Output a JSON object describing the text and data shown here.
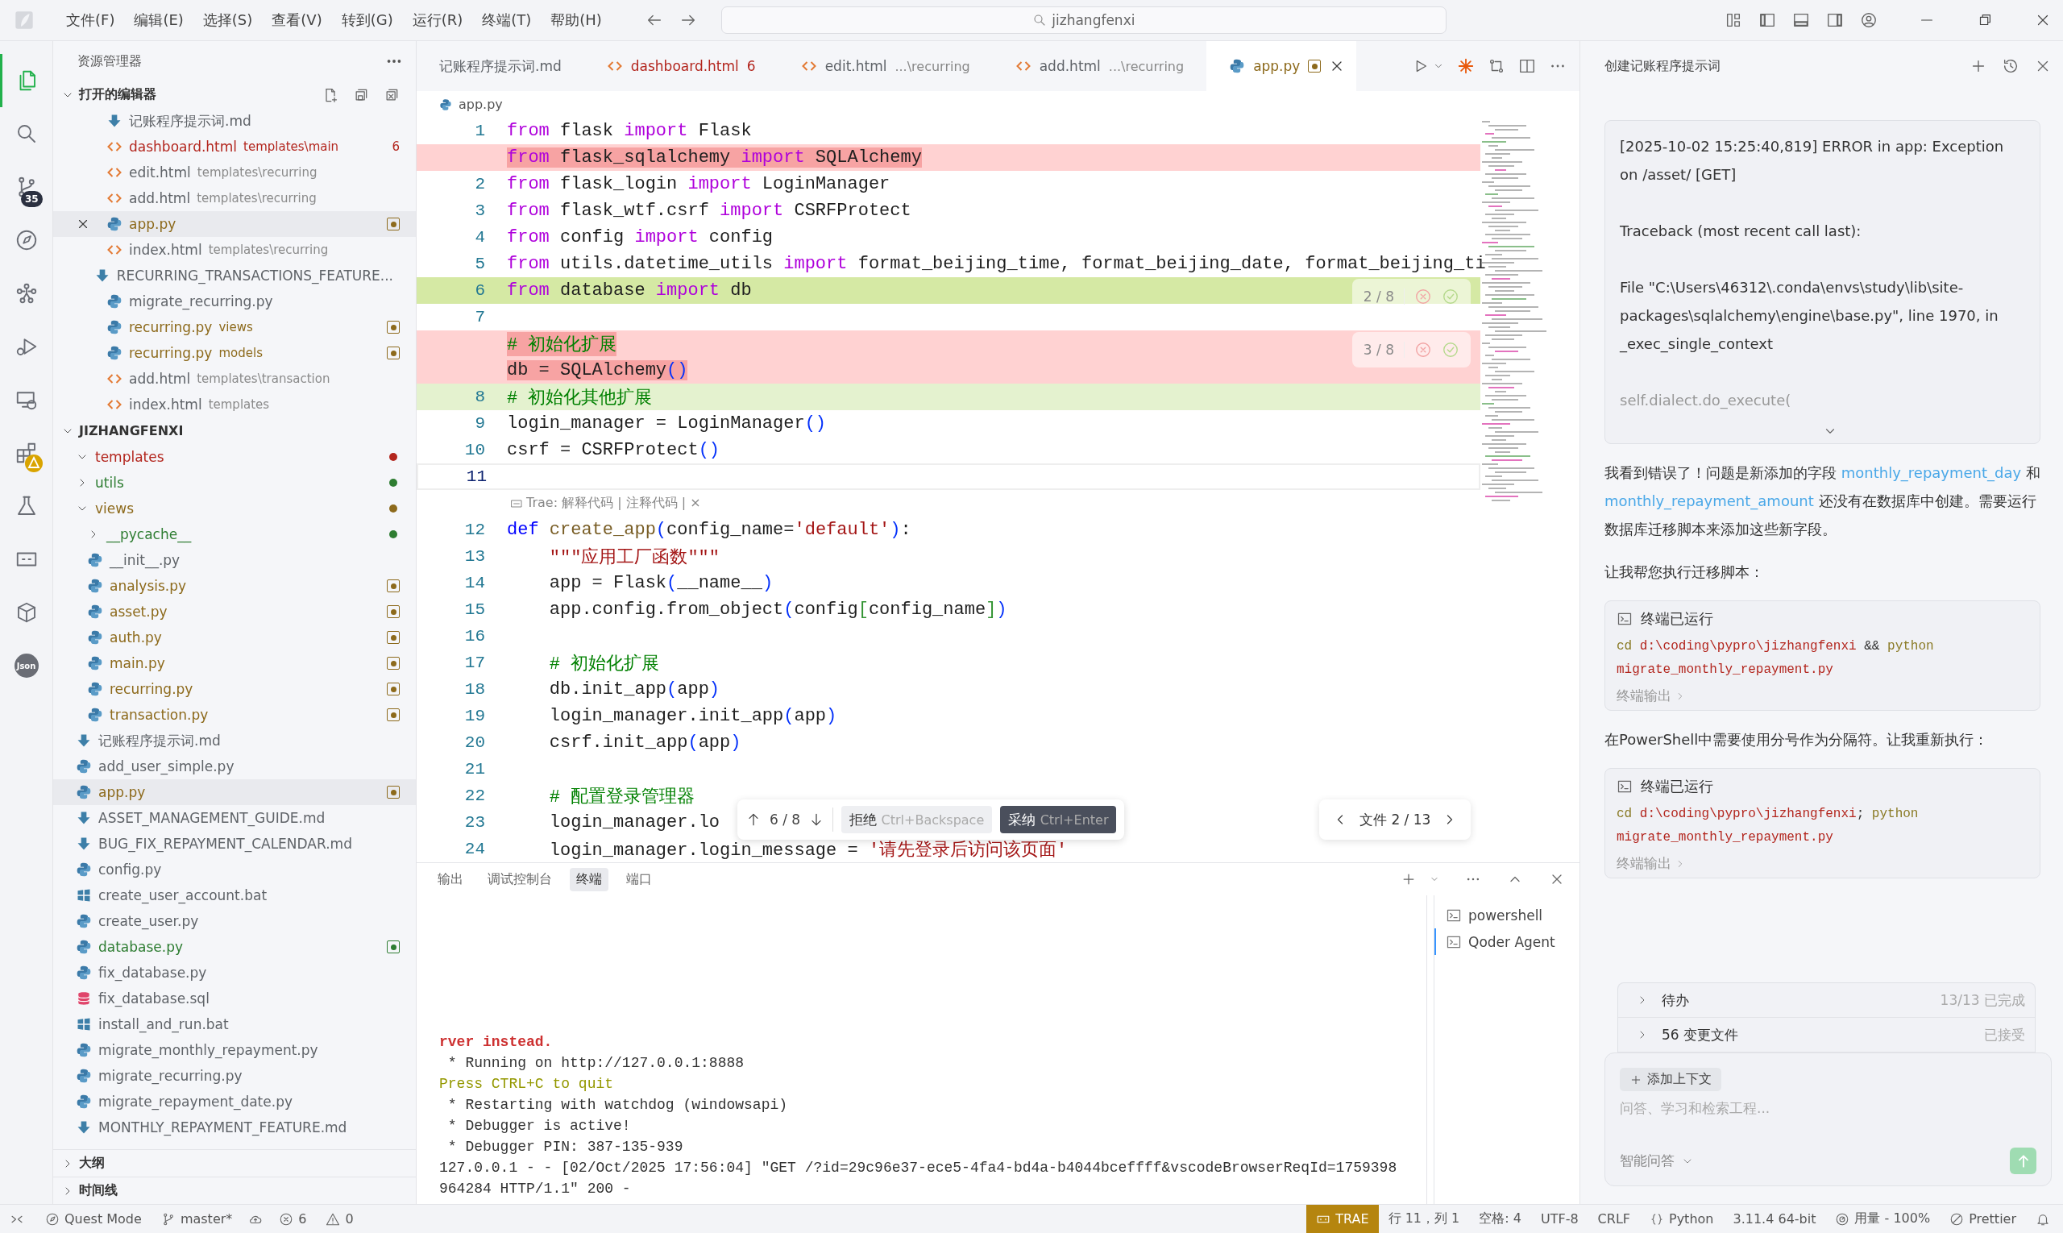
{
  "menu": [
    "文件(F)",
    "编辑(E)",
    "选择(S)",
    "查看(V)",
    "转到(G)",
    "运行(R)",
    "终端(T)",
    "帮助(H)"
  ],
  "command_center": "jizhangfenxi",
  "activity_bar": [
    {
      "kind": "explorer",
      "selected": true,
      "alert": false
    },
    {
      "kind": "search",
      "selected": false,
      "alert": false
    },
    {
      "kind": "source-control",
      "selected": false,
      "badge": "35",
      "alert": false
    },
    {
      "kind": "compass",
      "selected": false,
      "alert": false
    },
    {
      "kind": "graph",
      "selected": false,
      "alert": false
    },
    {
      "kind": "run-debug",
      "selected": false,
      "alert": false
    },
    {
      "kind": "remote",
      "selected": false,
      "alert": false
    },
    {
      "kind": "extensions",
      "selected": false,
      "alert": true
    },
    {
      "kind": "testing",
      "selected": false,
      "alert": false
    },
    {
      "kind": "chat",
      "selected": false,
      "alert": false
    },
    {
      "kind": "package",
      "selected": false,
      "alert": false
    },
    {
      "kind": "json",
      "selected": false,
      "label": "Json",
      "alert": false
    }
  ],
  "explorer": {
    "title": "资源管理器",
    "open_editors": {
      "title": "打开的编辑器",
      "expanded": true,
      "items": [
        {
          "name": "记账程序提示词.md",
          "kind": "md",
          "color": "#5f6368",
          "modified": false,
          "selected": false
        },
        {
          "name": "dashboard.html",
          "detail": "templates\\main",
          "kind": "html",
          "color": "#b3261e",
          "problems": "6",
          "modified": false,
          "selected": false
        },
        {
          "name": "edit.html",
          "detail": "templates\\recurring",
          "kind": "html",
          "color": "#5f6368",
          "modified": false,
          "selected": false
        },
        {
          "name": "add.html",
          "detail": "templates\\recurring",
          "kind": "html",
          "color": "#5f6368",
          "modified": false,
          "selected": false
        },
        {
          "name": "app.py",
          "kind": "py",
          "color": "#8d6a1c",
          "modified": true,
          "selected": true
        },
        {
          "name": "index.html",
          "detail": "templates\\recurring",
          "kind": "html",
          "color": "#5f6368",
          "modified": false,
          "selected": false
        },
        {
          "name": "RECURRING_TRANSACTIONS_FEATURE...",
          "kind": "md",
          "color": "#5f6368",
          "modified": false,
          "selected": false
        },
        {
          "name": "migrate_recurring.py",
          "kind": "py",
          "color": "#5f6368",
          "modified": false,
          "selected": false
        },
        {
          "name": "recurring.py",
          "detail": "views",
          "kind": "py",
          "color": "#8d6a1c",
          "modified": true,
          "selected": false
        },
        {
          "name": "recurring.py",
          "detail": "models",
          "kind": "py",
          "color": "#8d6a1c",
          "modified": true,
          "selected": false
        },
        {
          "name": "add.html",
          "detail": "templates\\transaction",
          "kind": "html",
          "color": "#5f6368",
          "modified": false,
          "selected": false
        },
        {
          "name": "index.html",
          "detail": "templates",
          "kind": "html",
          "color": "#5f6368",
          "modified": false,
          "selected": false
        }
      ]
    },
    "project": {
      "title": "JIZHANGFENXI",
      "expanded": true,
      "children": [
        {
          "name": "templates",
          "kind": "folder",
          "expanded": true,
          "color": "#b3261e",
          "modified": true,
          "selected": false
        },
        {
          "name": "utils",
          "kind": "folder",
          "expanded": false,
          "color": "#2e7d32",
          "modified": true,
          "selected": false
        },
        {
          "name": "views",
          "kind": "folder",
          "expanded": true,
          "color": "#8d6a1c",
          "modified": true,
          "selected": false,
          "children": [
            {
              "name": "__pycache__",
              "kind": "folder",
              "expanded": false,
              "color": "#2e7d32",
              "modified": true,
              "selected": false
            },
            {
              "name": "__init__.py",
              "kind": "py",
              "color": "#5f6368",
              "modified": false,
              "selected": false
            },
            {
              "name": "analysis.py",
              "kind": "py",
              "color": "#8d6a1c",
              "modified": true,
              "selected": false
            },
            {
              "name": "asset.py",
              "kind": "py",
              "color": "#8d6a1c",
              "modified": true,
              "selected": false
            },
            {
              "name": "auth.py",
              "kind": "py",
              "color": "#8d6a1c",
              "modified": true,
              "selected": false
            },
            {
              "name": "main.py",
              "kind": "py",
              "color": "#8d6a1c",
              "modified": true,
              "selected": false
            },
            {
              "name": "recurring.py",
              "kind": "py",
              "color": "#8d6a1c",
              "modified": true,
              "selected": false
            },
            {
              "name": "transaction.py",
              "kind": "py",
              "color": "#8d6a1c",
              "modified": true,
              "selected": false
            }
          ]
        },
        {
          "name": "记账程序提示词.md",
          "kind": "md",
          "color": "#5f6368",
          "modified": false,
          "selected": false
        },
        {
          "name": "add_user_simple.py",
          "kind": "py",
          "color": "#5f6368",
          "modified": false,
          "selected": false
        },
        {
          "name": "app.py",
          "kind": "py",
          "color": "#8d6a1c",
          "modified": true,
          "selected": true
        },
        {
          "name": "ASSET_MANAGEMENT_GUIDE.md",
          "kind": "md",
          "color": "#5f6368",
          "modified": false,
          "selected": false
        },
        {
          "name": "BUG_FIX_REPAYMENT_CALENDAR.md",
          "kind": "md",
          "color": "#5f6368",
          "modified": false,
          "selected": false
        },
        {
          "name": "config.py",
          "kind": "py",
          "color": "#5f6368",
          "modified": false,
          "selected": false
        },
        {
          "name": "create_user_account.bat",
          "kind": "bat",
          "color": "#5f6368",
          "modified": false,
          "selected": false
        },
        {
          "name": "create_user.py",
          "kind": "py",
          "color": "#5f6368",
          "modified": false,
          "selected": false
        },
        {
          "name": "database.py",
          "kind": "py",
          "color": "#2e7d32",
          "modified": true,
          "selected": false
        },
        {
          "name": "fix_database.py",
          "kind": "py",
          "color": "#5f6368",
          "modified": false,
          "selected": false
        },
        {
          "name": "fix_database.sql",
          "kind": "sql",
          "color": "#5f6368",
          "modified": false,
          "selected": false
        },
        {
          "name": "install_and_run.bat",
          "kind": "bat",
          "color": "#5f6368",
          "modified": false,
          "selected": false
        },
        {
          "name": "migrate_monthly_repayment.py",
          "kind": "py",
          "color": "#5f6368",
          "modified": false,
          "selected": false
        },
        {
          "name": "migrate_recurring.py",
          "kind": "py",
          "color": "#5f6368",
          "modified": false,
          "selected": false
        },
        {
          "name": "migrate_repayment_date.py",
          "kind": "py",
          "color": "#5f6368",
          "modified": false,
          "selected": false
        },
        {
          "name": "MONTHLY_REPAYMENT_FEATURE.md",
          "kind": "md",
          "color": "#5f6368",
          "modified": false,
          "selected": false
        }
      ]
    },
    "sections": [
      {
        "title": "大纲",
        "expanded": false
      },
      {
        "title": "时间线",
        "expanded": false
      }
    ]
  },
  "editor": {
    "tabs": [
      {
        "label": "记账程序提示词.md",
        "color": "#5f6368",
        "modified": false,
        "selected": false
      },
      {
        "label": "dashboard.html",
        "kind": "html",
        "problems": "6",
        "color": "#b3261e",
        "modified": false,
        "selected": false
      },
      {
        "label": "edit.html",
        "kind": "html",
        "detail": "...\\recurring",
        "color": "#5f6368",
        "modified": false,
        "selected": false
      },
      {
        "label": "add.html",
        "kind": "html",
        "detail": "...\\recurring",
        "color": "#5f6368",
        "modified": false,
        "selected": false
      },
      {
        "label": "app.py",
        "kind": "py",
        "color": "#8d6a1c",
        "modified": true,
        "selected": true
      }
    ],
    "breadcrumb": "app.py",
    "lines": [
      {
        "number": "1",
        "kind": "code",
        "tokens": [
          {
            "kind": "keyword",
            "text": "from"
          },
          {
            "kind": "plain",
            "text": " flask "
          },
          {
            "kind": "keyword",
            "text": "import"
          },
          {
            "kind": "plain",
            "text": " Flask"
          }
        ]
      },
      {
        "kind": "removed",
        "tokens": [
          {
            "kind": "keyword",
            "text": "from"
          },
          {
            "kind": "plain",
            "text": " flask_sqlalchemy "
          },
          {
            "kind": "keyword",
            "text": "import"
          },
          {
            "kind": "plain",
            "text": " SQLAlchemy"
          }
        ]
      },
      {
        "number": "2",
        "kind": "code",
        "tokens": [
          {
            "kind": "keyword",
            "text": "from"
          },
          {
            "kind": "plain",
            "text": " flask_login "
          },
          {
            "kind": "keyword",
            "text": "import"
          },
          {
            "kind": "plain",
            "text": " LoginManager"
          }
        ]
      },
      {
        "number": "3",
        "kind": "code",
        "tokens": [
          {
            "kind": "keyword",
            "text": "from"
          },
          {
            "kind": "plain",
            "text": " flask_wtf.csrf "
          },
          {
            "kind": "keyword",
            "text": "import"
          },
          {
            "kind": "plain",
            "text": " CSRFProtect"
          }
        ]
      },
      {
        "number": "4",
        "kind": "code",
        "tokens": [
          {
            "kind": "keyword",
            "text": "from"
          },
          {
            "kind": "plain",
            "text": " config "
          },
          {
            "kind": "keyword",
            "text": "import"
          },
          {
            "kind": "plain",
            "text": " config"
          }
        ]
      },
      {
        "number": "5",
        "kind": "code",
        "tokens": [
          {
            "kind": "keyword",
            "text": "from"
          },
          {
            "kind": "plain",
            "text": " utils.datetime_utils "
          },
          {
            "kind": "keyword",
            "text": "import"
          },
          {
            "kind": "plain",
            "text": " format_beijing_time, format_beijing_date, format_beijing_ti"
          }
        ]
      },
      {
        "number": "6",
        "kind": "added",
        "hunk": "2 / 8",
        "tokens": [
          {
            "kind": "keyword",
            "text": "from"
          },
          {
            "kind": "plain",
            "text": " database "
          },
          {
            "kind": "keyword",
            "text": "import"
          },
          {
            "kind": "plain",
            "text": " db"
          }
        ]
      },
      {
        "number": "7",
        "kind": "code"
      },
      {
        "kind": "removed",
        "hunk": "3 / 8",
        "tokens": [
          {
            "kind": "comment",
            "text": "# 初始化扩展"
          }
        ]
      },
      {
        "kind": "removed",
        "tokens": [
          {
            "kind": "plain",
            "text": "db = SQLAlchemy"
          },
          {
            "kind": "bracket",
            "text": "()"
          }
        ]
      },
      {
        "number": "8",
        "kind": "modified",
        "tokens": [
          {
            "kind": "comment",
            "text": "# 初始化其他扩展"
          }
        ]
      },
      {
        "number": "9",
        "kind": "code",
        "tokens": [
          {
            "kind": "plain",
            "text": "login_manager = LoginManager"
          },
          {
            "kind": "bracket",
            "text": "()"
          }
        ]
      },
      {
        "number": "10",
        "kind": "code",
        "tokens": [
          {
            "kind": "plain",
            "text": "csrf = CSRFProtect"
          },
          {
            "kind": "bracket",
            "text": "()"
          }
        ]
      },
      {
        "number": "11",
        "kind": "code",
        "cursor": true
      },
      {
        "kind": "lens",
        "text": "Trae: 解释代码 | 注释代码 | ×"
      },
      {
        "number": "12",
        "kind": "code",
        "tokens": [
          {
            "kind": "def",
            "text": "def "
          },
          {
            "kind": "function",
            "text": "create_app"
          },
          {
            "kind": "bracket",
            "text": "("
          },
          {
            "kind": "plain",
            "text": "config_name="
          },
          {
            "kind": "string",
            "text": "'default'"
          },
          {
            "kind": "bracket",
            "text": ")"
          },
          {
            "kind": "plain",
            "text": ":"
          }
        ]
      },
      {
        "number": "13",
        "kind": "code",
        "tokens": [
          {
            "kind": "string",
            "text": "    \"\"\"应用工厂函数\"\"\""
          }
        ]
      },
      {
        "number": "14",
        "kind": "code",
        "tokens": [
          {
            "kind": "plain",
            "text": "    app = Flask"
          },
          {
            "kind": "bracket",
            "text": "("
          },
          {
            "kind": "plain",
            "text": "__name__"
          },
          {
            "kind": "bracket",
            "text": ")"
          }
        ]
      },
      {
        "number": "15",
        "kind": "code",
        "tokens": [
          {
            "kind": "plain",
            "text": "    app.config.from_object"
          },
          {
            "kind": "bracket",
            "text": "("
          },
          {
            "kind": "plain",
            "text": "config"
          },
          {
            "kind": "bracket2",
            "text": "["
          },
          {
            "kind": "plain",
            "text": "config_name"
          },
          {
            "kind": "bracket2",
            "text": "]"
          },
          {
            "kind": "bracket",
            "text": ")"
          }
        ]
      },
      {
        "number": "16",
        "kind": "code"
      },
      {
        "number": "17",
        "kind": "code",
        "tokens": [
          {
            "kind": "comment",
            "text": "    # 初始化扩展"
          }
        ]
      },
      {
        "number": "18",
        "kind": "code",
        "tokens": [
          {
            "kind": "plain",
            "text": "    db.init_app"
          },
          {
            "kind": "bracket",
            "text": "("
          },
          {
            "kind": "plain",
            "text": "app"
          },
          {
            "kind": "bracket",
            "text": ")"
          }
        ]
      },
      {
        "number": "19",
        "kind": "code",
        "tokens": [
          {
            "kind": "plain",
            "text": "    login_manager.init_app"
          },
          {
            "kind": "bracket",
            "text": "("
          },
          {
            "kind": "plain",
            "text": "app"
          },
          {
            "kind": "bracket",
            "text": ")"
          }
        ]
      },
      {
        "number": "20",
        "kind": "code",
        "tokens": [
          {
            "kind": "plain",
            "text": "    csrf.init_app"
          },
          {
            "kind": "bracket",
            "text": "("
          },
          {
            "kind": "plain",
            "text": "app"
          },
          {
            "kind": "bracket",
            "text": ")"
          }
        ]
      },
      {
        "number": "21",
        "kind": "code"
      },
      {
        "number": "22",
        "kind": "code",
        "tokens": [
          {
            "kind": "comment",
            "text": "    # 配置登录管理器"
          }
        ]
      },
      {
        "number": "23",
        "kind": "code",
        "tokens": [
          {
            "kind": "plain",
            "text": "    login_manager.lo"
          }
        ]
      },
      {
        "number": "24",
        "kind": "code",
        "tokens": [
          {
            "kind": "plain",
            "text": "    login_manager.login_message = "
          },
          {
            "kind": "string",
            "text": "'请先登录后访问该页面'"
          }
        ]
      }
    ],
    "review_bar": {
      "position": "6 / 8",
      "reject": {
        "label": "拒绝",
        "shortcut": "Ctrl+Backspace"
      },
      "accept": {
        "label": "采纳",
        "shortcut": "Ctrl+Enter"
      },
      "file_position": "文件 2 / 13"
    }
  },
  "panel": {
    "tabs": [
      {
        "label": "输出",
        "selected": false
      },
      {
        "label": "调试控制台",
        "selected": false
      },
      {
        "label": "终端",
        "selected": true
      },
      {
        "label": "端口",
        "selected": false
      }
    ],
    "terminal_lines": [
      {
        "kind": "error",
        "text": "rver instead."
      },
      {
        "kind": "normal",
        "text": " * Running on http://127.0.0.1:8888"
      },
      {
        "kind": "warn",
        "text": "Press CTRL+C to quit"
      },
      {
        "kind": "normal",
        "text": " * Restarting with watchdog (windowsapi)"
      },
      {
        "kind": "normal",
        "text": " * Debugger is active!"
      },
      {
        "kind": "normal",
        "text": " * Debugger PIN: 387-135-939"
      },
      {
        "kind": "normal",
        "text": "127.0.0.1 - - [02/Oct/2025 17:56:04] \"GET /?id=29c96e37-ece5-4fa4-bd4a-b4044bceffff&vscodeBrowserReqId=1759398"
      },
      {
        "kind": "normal",
        "text": "964284 HTTP/1.1\" 200 -"
      }
    ],
    "terminals": [
      {
        "label": "powershell",
        "selected": false
      },
      {
        "label": "Qoder Agent",
        "selected": true
      }
    ]
  },
  "chat": {
    "title": "创建记账程序提示词",
    "log": [
      {
        "kind": "normal",
        "text": "[2025-10-02 15:25:40,819] ERROR in app: Exception on /asset/ [GET]"
      },
      {
        "kind": "normal",
        "text": "Traceback (most recent call last):"
      },
      {
        "kind": "normal",
        "text": "  File \"C:\\Users\\46312\\.conda\\envs\\study\\lib\\site-packages\\sqlalchemy\\engine\\base.py\", line 1970, in _exec_single_context"
      },
      {
        "kind": "faded",
        "text": "    self.dialect.do_execute("
      }
    ],
    "messages": [
      {
        "kind": "text",
        "parts": [
          {
            "kind": "text",
            "text": "我看到错误了！问题是新添加的字段 "
          },
          {
            "kind": "code",
            "text": "monthly_repayment_day"
          },
          {
            "kind": "text",
            "text": " 和 "
          },
          {
            "kind": "code",
            "text": "monthly_repayment_amount"
          },
          {
            "kind": "text",
            "text": " 还没有在数据库中创建。需要运行数据库迁移脚本来添加这些新字段。"
          }
        ]
      },
      {
        "kind": "text",
        "parts": [
          {
            "kind": "text",
            "text": "让我帮您执行迁移脚本："
          }
        ]
      },
      {
        "kind": "terminal",
        "title": "终端已运行",
        "command": [
          {
            "kind": "cmd",
            "text": "cd"
          },
          {
            "kind": "arg",
            "text": " d:\\coding\\pypro\\jizhangfenxi"
          },
          {
            "kind": "op",
            "text": " && "
          },
          {
            "kind": "cmd",
            "text": "python"
          },
          {
            "kind": "arg",
            "text": " migrate_monthly_repayment.py"
          }
        ],
        "footer": "终端输出"
      },
      {
        "kind": "text",
        "parts": [
          {
            "kind": "text",
            "text": "在PowerShell中需要使用分号作为分隔符。让我重新执行："
          }
        ]
      },
      {
        "kind": "terminal",
        "title": "终端已运行",
        "command": [
          {
            "kind": "cmd",
            "text": "cd"
          },
          {
            "kind": "arg",
            "text": " d:\\coding\\pypro\\jizhangfenxi"
          },
          {
            "kind": "op",
            "text": "; "
          },
          {
            "kind": "cmd",
            "text": "python"
          },
          {
            "kind": "arg",
            "text": " migrate_monthly_repayment.py"
          }
        ],
        "footer": "终端输出"
      }
    ],
    "summary": [
      {
        "label": "待办",
        "status": "13/13 已完成"
      },
      {
        "label": "56 变更文件",
        "status": "已接受"
      }
    ],
    "input": {
      "context_button": "添加上下文",
      "placeholder": "问答、学习和检索工程...",
      "mode": "智能问答"
    }
  },
  "status_bar": {
    "left": [
      {
        "kind": "remote"
      },
      {
        "kind": "compass",
        "text": "Quest Mode"
      },
      {
        "kind": "branch",
        "text": "master*"
      },
      {
        "kind": "sync"
      },
      {
        "kind": "error",
        "text": "6"
      },
      {
        "kind": "warning",
        "text": "0"
      }
    ],
    "right": [
      {
        "kind": "trae",
        "text": "TRAE",
        "highlighted": true
      },
      {
        "kind": "text",
        "text": "行 11，列 1",
        "highlighted": false
      },
      {
        "kind": "text",
        "text": "空格: 4",
        "highlighted": false
      },
      {
        "kind": "text",
        "text": "UTF-8",
        "highlighted": false
      },
      {
        "kind": "text",
        "text": "CRLF",
        "highlighted": false
      },
      {
        "kind": "braces",
        "text": "Python",
        "highlighted": false
      },
      {
        "kind": "text",
        "text": "3.11.4 64-bit",
        "highlighted": false
      },
      {
        "kind": "gauge",
        "text": "用量 - 100%",
        "highlighted": false
      },
      {
        "kind": "prohibit",
        "text": "Prettier",
        "highlighted": false
      },
      {
        "kind": "bell"
      }
    ]
  }
}
